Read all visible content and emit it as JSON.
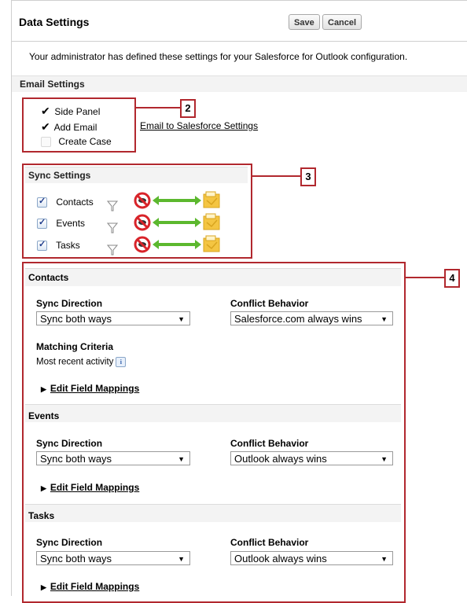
{
  "header": {
    "title": "Data Settings",
    "save_label": "Save",
    "cancel_label": "Cancel"
  },
  "intro_text": "Your administrator has defined these settings for your Salesforce for Outlook configuration.",
  "email_settings": {
    "heading": "Email Settings",
    "items": [
      {
        "label": "Side Panel",
        "checked": true
      },
      {
        "label": "Add Email",
        "checked": true
      },
      {
        "label": "Create Case",
        "checked": false
      }
    ],
    "link_label": "Email to Salesforce Settings"
  },
  "sync_settings": {
    "heading": "Sync Settings",
    "items": [
      {
        "label": "Contacts",
        "checked": true
      },
      {
        "label": "Events",
        "checked": true
      },
      {
        "label": "Tasks",
        "checked": true
      }
    ]
  },
  "callouts": [
    "2",
    "3",
    "4"
  ],
  "labels": {
    "sync_direction": "Sync Direction",
    "conflict_behavior": "Conflict Behavior",
    "matching_criteria": "Matching Criteria",
    "edit_field_mappings": "Edit Field Mappings"
  },
  "contacts": {
    "heading": "Contacts",
    "sync_direction": "Sync both ways",
    "conflict_behavior": "Salesforce.com always wins",
    "matching_criteria_value": "Most recent activity"
  },
  "events": {
    "heading": "Events",
    "sync_direction": "Sync both ways",
    "conflict_behavior": "Outlook always wins"
  },
  "tasks": {
    "heading": "Tasks",
    "sync_direction": "Sync both ways",
    "conflict_behavior": "Outlook always wins"
  },
  "colors": {
    "callout": "#b1282e",
    "section_bg": "#f3f3f3",
    "arrow_green": "#5cb82e",
    "outlook_yellow": "#f4c542",
    "no_sign_red": "#d8242a"
  },
  "icons": [
    "filter-icon",
    "salesforce-no-sign-icon",
    "sync-arrow-icon",
    "outlook-folder-icon",
    "info-icon",
    "expand-triangle-icon",
    "checkmark-icon"
  ]
}
